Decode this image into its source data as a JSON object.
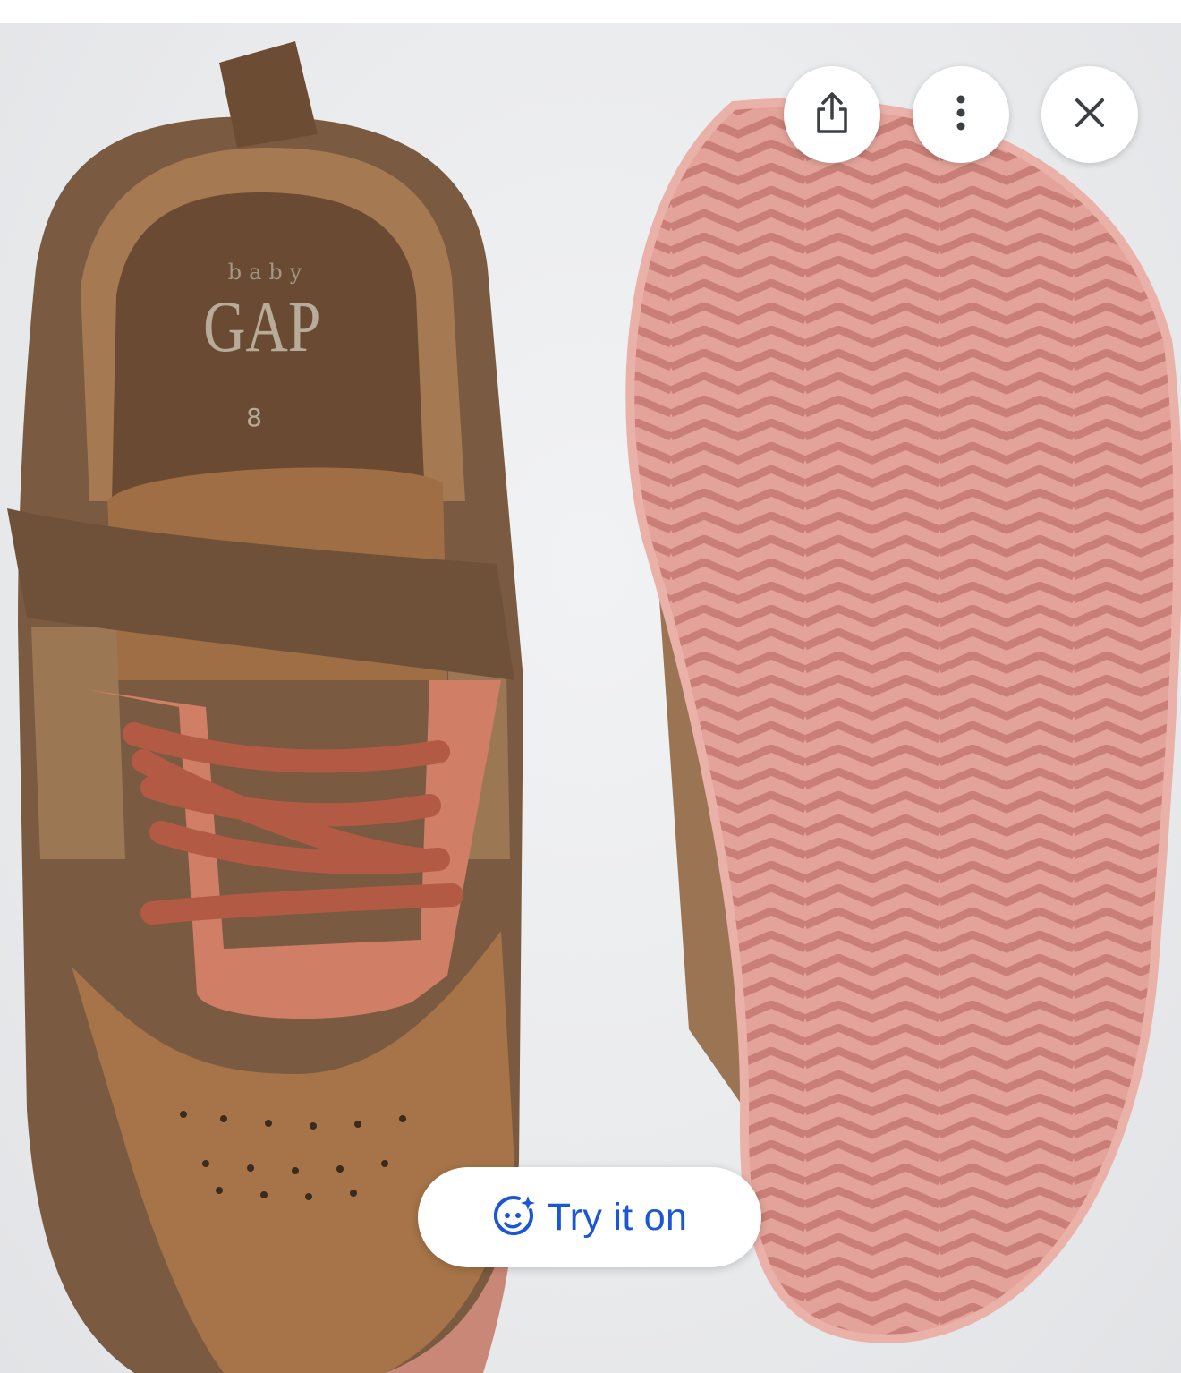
{
  "product_image": {
    "insole_brand_small": "baby",
    "insole_brand": "GAP",
    "insole_size": "8"
  },
  "toolbar": {
    "share_icon": "share-icon",
    "more_icon": "more-vert-icon",
    "close_icon": "close-icon"
  },
  "try_on_button": {
    "label": "Try it on",
    "icon": "face-sparkle-icon",
    "color": "#1a56d6"
  }
}
